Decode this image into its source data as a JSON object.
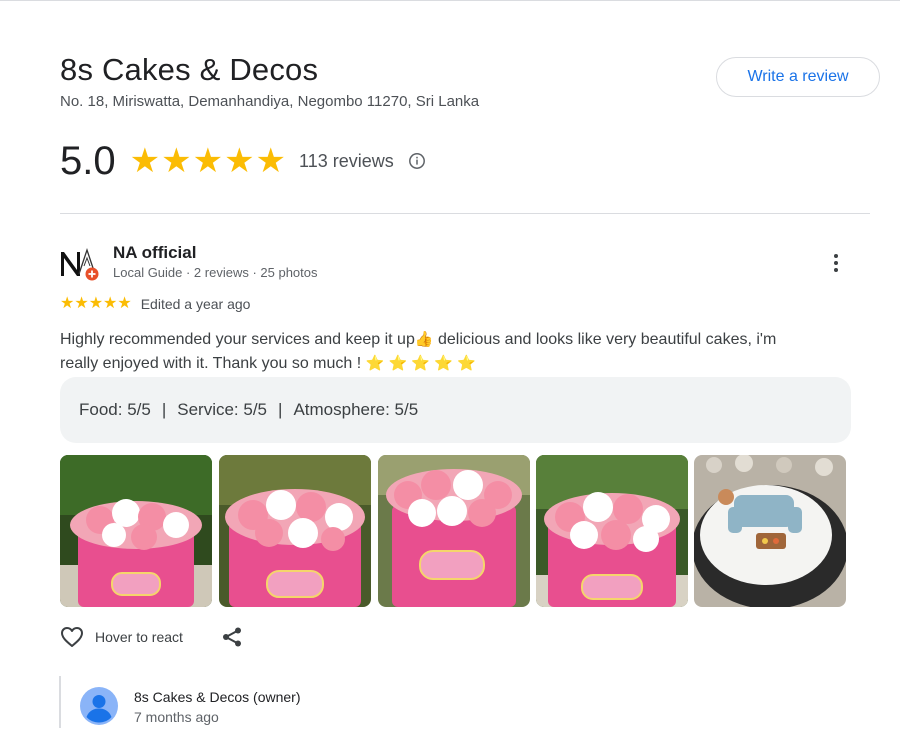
{
  "place": {
    "name": "8s Cakes & Decos",
    "address": "No. 18, Miriswatta, Demanhandiya, Negombo 11270, Sri Lanka",
    "write_review_label": "Write a review",
    "rating": "5.0",
    "stars_filled": 5,
    "review_count_label": "113 reviews"
  },
  "review": {
    "author": "NA official",
    "author_meta": "Local Guide · 2 reviews · 25 photos",
    "stars": 5,
    "edited_label": "Edited a year ago",
    "text_line1": "Highly recommended your services and keep it up",
    "text_line1_after": " delicious and looks like very beautiful cakes, i'm",
    "text_line2": "really enjoyed with it. Thank you so much ! ",
    "attributes": [
      "Food: 5/5",
      "Service: 5/5",
      "Atmosphere: 5/5"
    ],
    "photos": [
      {
        "name": "pink-flower-cake-photo"
      },
      {
        "name": "pink-flower-cake-photo"
      },
      {
        "name": "pink-flower-cake-photo"
      },
      {
        "name": "pink-flower-cake-photo"
      },
      {
        "name": "white-sofa-cake-photo"
      }
    ],
    "react_label": "Hover to react"
  },
  "owner_reply": {
    "name": "8s Cakes & Decos (owner)",
    "time": "7 months ago"
  },
  "colors": {
    "star": "#fbbc04",
    "link": "#1a73e8",
    "text": "#202124",
    "muted": "#5f6368",
    "chip_bg": "#f1f3f4"
  },
  "icons": [
    "info-icon",
    "more-vert-icon",
    "heart-icon",
    "share-icon",
    "person-icon",
    "thumbs-up-icon"
  ]
}
